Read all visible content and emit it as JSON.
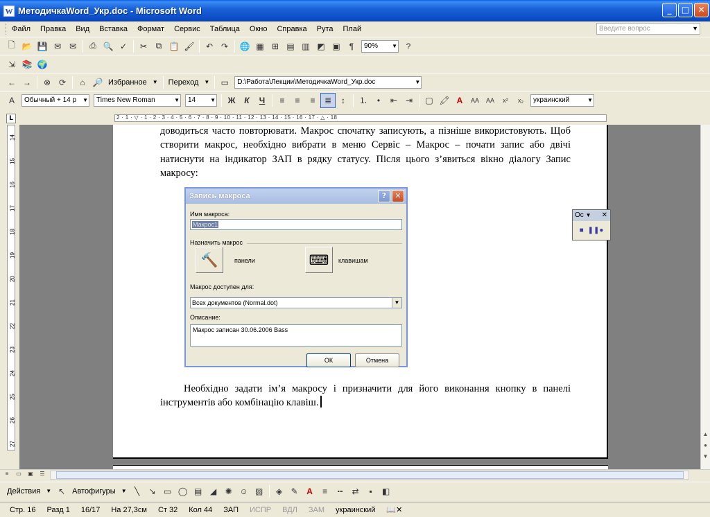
{
  "window": {
    "title": "МетодичкаWord_Укр.doc - Microsoft Word",
    "app_icon": "W"
  },
  "menu": {
    "items": [
      "Файл",
      "Правка",
      "Вид",
      "Вставка",
      "Формат",
      "Сервис",
      "Таблица",
      "Окно",
      "Справка",
      "Рута",
      "Плай"
    ],
    "help_placeholder": "Введите вопрос"
  },
  "toolbar_standard": {
    "zoom": "90%"
  },
  "toolbar_web": {
    "favorites": "Избранное",
    "go": "Переход",
    "address": "D:\\Работа\\Лекции\\МетодичкаWord_Укр.doc"
  },
  "toolbar_format": {
    "style": "Обычный + 14 р",
    "font": "Times New Roman",
    "size": "14",
    "bold": "Ж",
    "italic": "К",
    "underline": "Ч",
    "language": "украинский"
  },
  "ruler": {
    "h_marks": "2 · 1 · ▽ · 1 · 2 · 3 · 4 · 5 · 6 · 7 · 8 · 9 · 10 · 11 · 12 · 13 · 14 · 15 · 16 · 17 · △ · 18",
    "v_numbers": [
      "14",
      "15",
      "16",
      "17",
      "18",
      "19",
      "20",
      "21",
      "22",
      "23",
      "24",
      "25",
      "26",
      "27"
    ]
  },
  "document": {
    "paragraph1": "доводиться часто повторювати. Макрос спочатку записують, а пізніше використовують. Щоб створити макрос, необхідно вибрати в меню Сервіс – Макрос – почати запис або двічі натиснути на індикатор ЗАП в рядку статусу. Після цього з’явиться вікно діалогу Запис макросу:",
    "paragraph2": "Необхідно задати ім’я макросу і призначити для його виконання кнопку в панелі інструментів або комбінацію клавіш."
  },
  "dialog": {
    "title": "Запись макроса",
    "name_label": "Имя макроса:",
    "name_value": "Макрос1",
    "assign_label": "Назначить макрос",
    "toolbars_label": "панели",
    "keyboard_label": "клавишам",
    "store_label": "Макрос доступен для:",
    "store_value": "Всех документов (Normal.dot)",
    "desc_label": "Описание:",
    "desc_value": "Макрос записан 30.06.2006 Bass",
    "ok": "ОК",
    "cancel": "Отмена"
  },
  "stop_toolbar": {
    "title": "Ос"
  },
  "drawing": {
    "actions": "Действия",
    "autoshapes": "Автофигуры"
  },
  "status": {
    "page": "Стр. 16",
    "section": "Разд 1",
    "pages": "16/17",
    "at": "На 27,3см",
    "line": "Ст 32",
    "col": "Кол 44",
    "rec": "ЗАП",
    "trk": "ИСПР",
    "ext": "ВДЛ",
    "ovr": "ЗАМ",
    "lang": "украинский"
  }
}
